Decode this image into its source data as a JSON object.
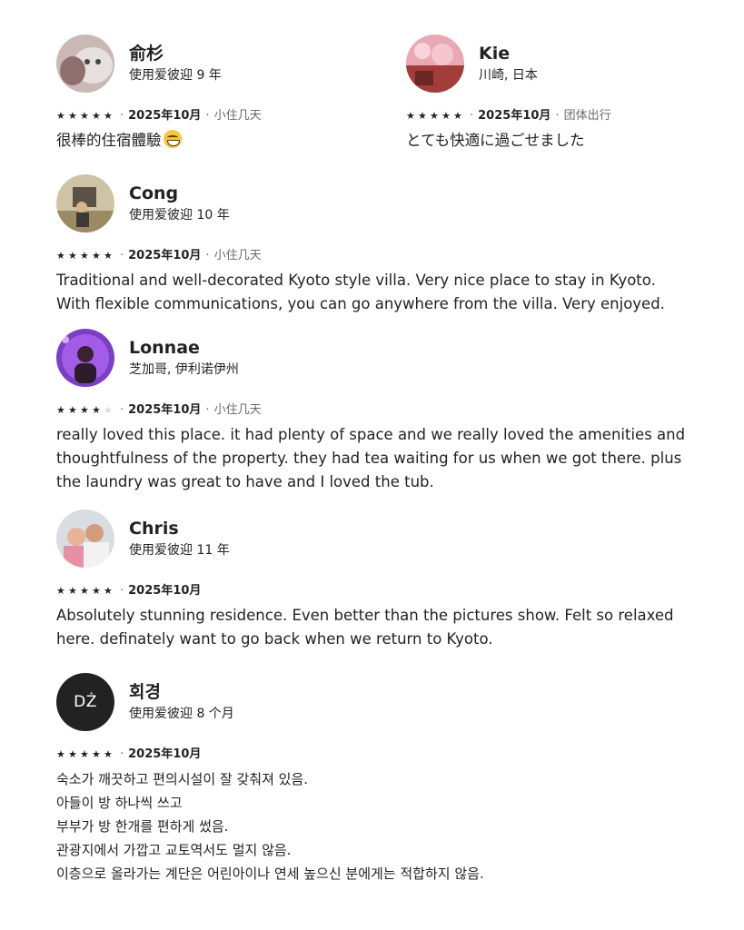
{
  "reviews": [
    {
      "name": "俞杉",
      "sub": "使用爱彼迎 9 年",
      "rating": 5,
      "date": "2025年10月",
      "stay": "小住几天",
      "lines": [
        "很棒的住宿體驗"
      ],
      "emoji": "grinning-squint-emoji"
    },
    {
      "name": "Kie",
      "sub": "川崎, 日本",
      "rating": 5,
      "date": "2025年10月",
      "stay": "团体出行",
      "lines": [
        "とても快適に過ごせました"
      ]
    },
    {
      "name": "Cong",
      "sub": "使用爱彼迎 10 年",
      "rating": 5,
      "date": "2025年10月",
      "stay": "小住几天",
      "lines": [
        "Traditional and well-decorated Kyoto style villa. Very nice place to stay in Kyoto.",
        "With flexible communications, you can go anywhere from the villa. Very enjoyed."
      ]
    },
    {
      "name": "Lonnae",
      "sub": "芝加哥, 伊利诺伊州",
      "rating": 4,
      "date": "2025年10月",
      "stay": "小住几天",
      "lines": [
        "really loved this place.  it had plenty of space and we really loved the amenities and",
        "thoughtfulness of the property. they had tea waiting for us when we got there. plus",
        "the laundry was great to have and I loved the tub."
      ]
    },
    {
      "name": "Chris",
      "sub": "使用爱彼迎 11 年",
      "rating": 5,
      "date": "2025年10月",
      "stay": "",
      "lines": [
        "Absolutely stunning residence. Even better than the pictures show. Felt so relaxed",
        "here. definately want to go back when we return to Kyoto."
      ]
    },
    {
      "name": "회경",
      "sub": "使用爱彼迎 8 个月",
      "initials": "DŻ",
      "rating": 5,
      "date": "2025年10月",
      "stay": "",
      "lines": [
        "숙소가 깨끗하고 편의시설이 잘 갖춰져  있음.",
        "아들이 방 하나씩 쓰고",
        "부부가  방 한개를 편하게 썼음.",
        "관광지에서 가깝고 교토역서도 멀지 않음.",
        "이층으로 올라가는 계단은 어린아이나  연세 높으신 분에게는 적합하지 않음."
      ]
    }
  ],
  "meta_separator": "·",
  "star_glyph": "★",
  "colors": {
    "text": "#222222",
    "muted": "#6a6a6a",
    "star_off": "#dddddd"
  }
}
